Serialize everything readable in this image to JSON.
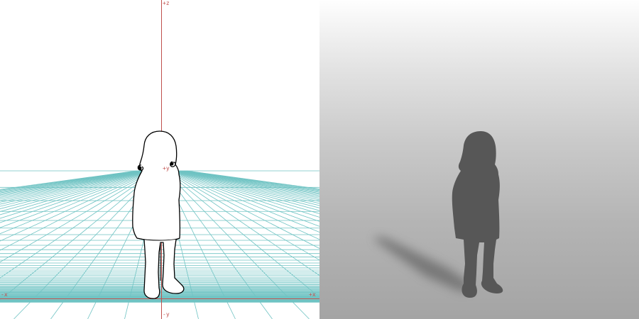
{
  "viewport": {
    "axis_labels": {
      "z_pos": "+z",
      "y_pos": "+y",
      "y_neg": "-y",
      "x_neg": "-x",
      "x_pos": "+x"
    }
  },
  "colors": {
    "grid": "#6fc3c3",
    "axis": "#c0504d",
    "outline": "#000000",
    "silhouette": "#575757",
    "shadow": "#6e6e6e"
  }
}
